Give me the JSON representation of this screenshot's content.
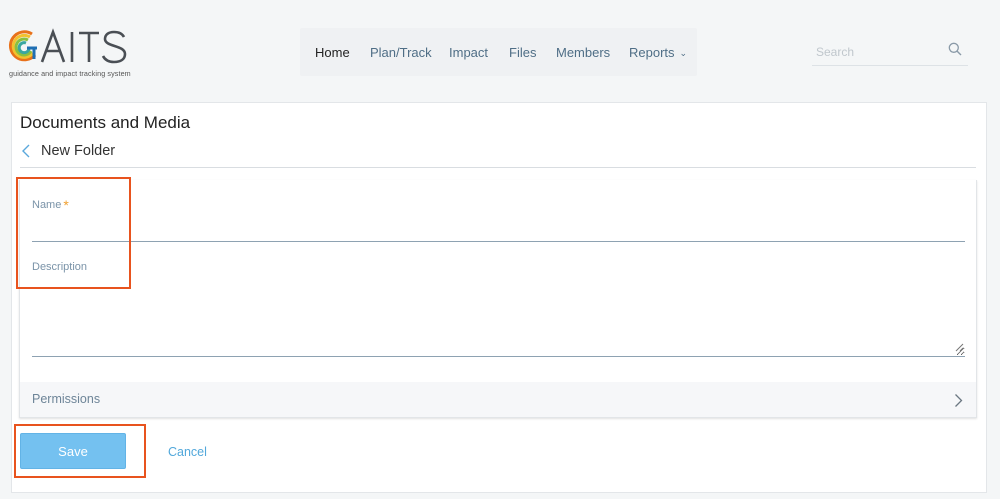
{
  "brand": {
    "logo_text": "GAITS",
    "tagline": "guidance and impact tracking system"
  },
  "nav": {
    "items": [
      {
        "label": "Home",
        "active": true
      },
      {
        "label": "Plan/Track"
      },
      {
        "label": "Impact"
      },
      {
        "label": "Files"
      },
      {
        "label": "Members"
      },
      {
        "label": "Reports",
        "has_dropdown": true
      }
    ]
  },
  "search": {
    "placeholder": "Search",
    "value": ""
  },
  "page": {
    "title": "Documents and Media",
    "subtitle": "New Folder"
  },
  "form": {
    "name_label": "Name",
    "required_mark": "*",
    "name_value": "",
    "description_label": "Description",
    "description_value": "",
    "permissions_label": "Permissions",
    "save_label": "Save",
    "cancel_label": "Cancel"
  },
  "colors": {
    "accent": "#74c1f0",
    "link": "#52a8db",
    "required": "#f0a030",
    "highlight": "#e8531e",
    "logo_arc_blue": "#1f6fb3",
    "logo_arc_teal": "#3aa7a0",
    "logo_arc_green": "#8bbf3f",
    "logo_arc_yellow": "#f2c12e",
    "logo_arc_orange": "#e8711a"
  }
}
